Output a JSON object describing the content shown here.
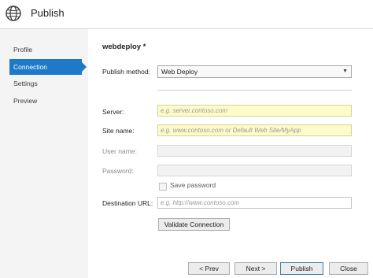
{
  "window": {
    "title": "Publish"
  },
  "sidebar": {
    "items": [
      {
        "label": "Profile",
        "active": false
      },
      {
        "label": "Connection",
        "active": true
      },
      {
        "label": "Settings",
        "active": false
      },
      {
        "label": "Preview",
        "active": false
      }
    ]
  },
  "main": {
    "profile_name": "webdeploy *",
    "publish_method": {
      "label": "Publish method:",
      "value": "Web Deploy"
    },
    "server": {
      "label": "Server:",
      "placeholder": "e.g. server.contoso.com",
      "value": ""
    },
    "site_name": {
      "label": "Site name:",
      "placeholder": "e.g. www.contoso.com or Default Web Site/MyApp",
      "value": ""
    },
    "user_name": {
      "label": "User name:",
      "value": ""
    },
    "password": {
      "label": "Password:",
      "value": ""
    },
    "save_password": {
      "label": "Save password",
      "checked": false
    },
    "destination_url": {
      "label": "Destination URL:",
      "placeholder": "e.g. http://www.contoso.com",
      "value": ""
    },
    "validate_button": "Validate Connection"
  },
  "footer": {
    "prev": "< Prev",
    "next": "Next >",
    "publish": "Publish",
    "close": "Close"
  },
  "colors": {
    "accent": "#1e7ac9",
    "highlight_field": "#fdfbc9",
    "sidebar_bg": "#f4f4f4"
  }
}
